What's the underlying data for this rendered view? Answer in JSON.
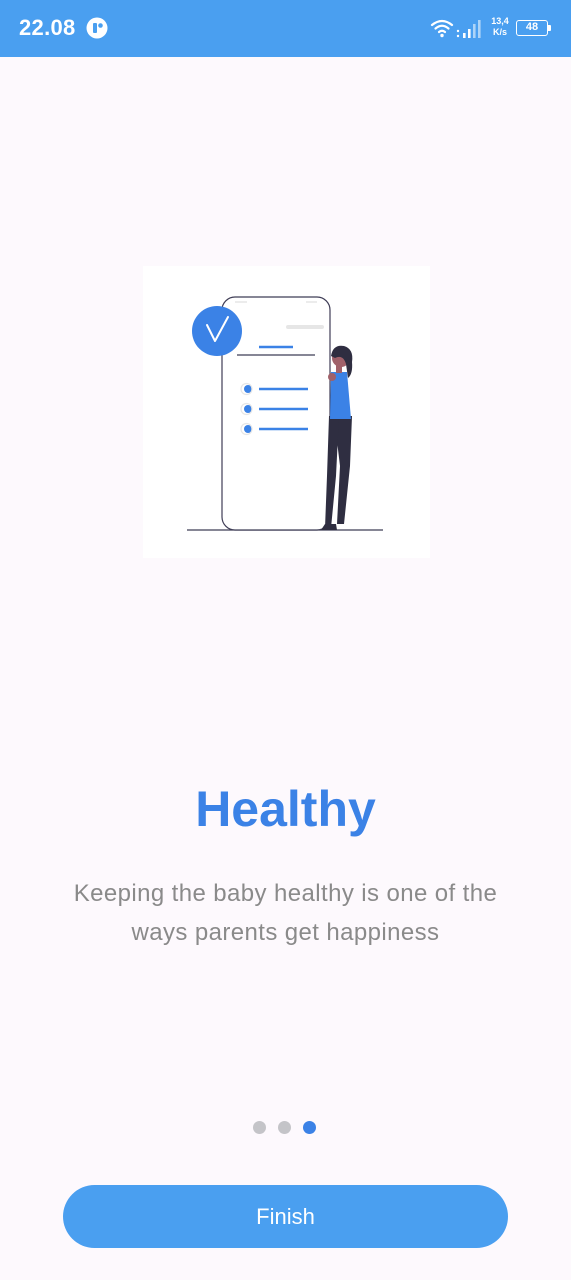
{
  "status_bar": {
    "time": "22.08",
    "net_speed_value": "13,4",
    "net_speed_unit": "K/s",
    "battery": "48",
    "icons": [
      "app-notification-icon",
      "wifi-icon",
      "signal-icon",
      "battery-icon"
    ]
  },
  "onboarding": {
    "illustration": "checklist-phone-person-illustration",
    "title": "Healthy",
    "description": "Keeping the baby healthy is one of the ways parents get happiness",
    "page_indicator": {
      "total": 3,
      "current": 3
    },
    "finish_label": "Finish"
  },
  "colors": {
    "status_bar": "#4a9ff0",
    "accent": "#3b82e6",
    "background": "#fdf9fd",
    "description_text": "#8a8a8a",
    "dot_inactive": "#c4c4c8"
  }
}
